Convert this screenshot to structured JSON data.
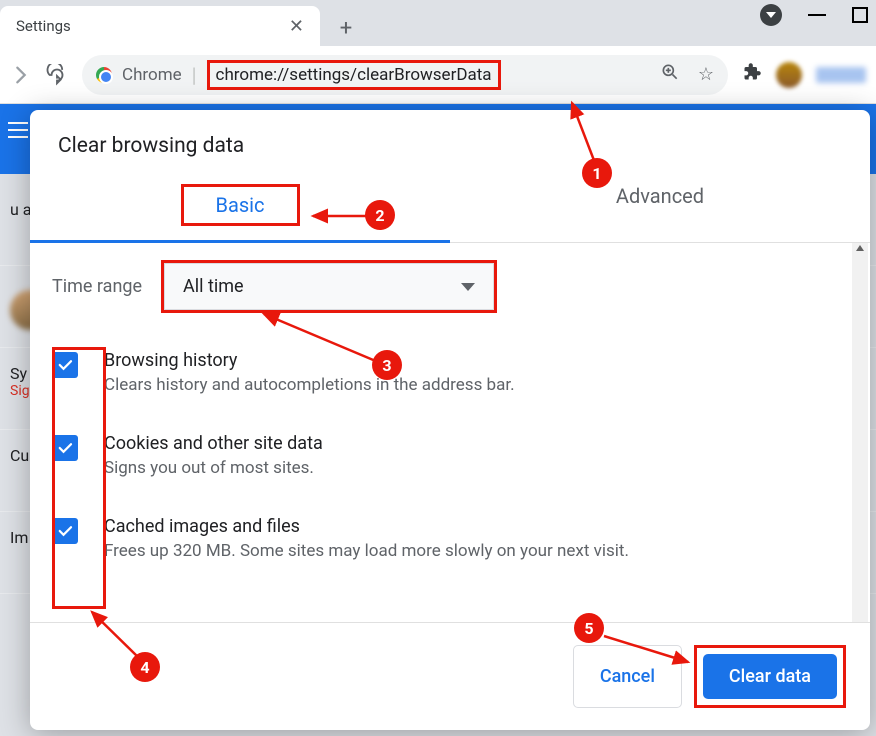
{
  "tab": {
    "title": "Settings"
  },
  "omnibox": {
    "label": "Chrome",
    "url": "chrome://settings/clearBrowserData"
  },
  "background": {
    "row1_truncated": "u a",
    "row2_label": "Sy",
    "row2_sub": "Sig",
    "row3_label": "Cu",
    "row4_label": "Im"
  },
  "dialog": {
    "title": "Clear browsing data",
    "tabs": {
      "basic": "Basic",
      "advanced": "Advanced"
    },
    "time_range_label": "Time range",
    "time_range_value": "All time",
    "items": [
      {
        "title": "Browsing history",
        "desc": "Clears history and autocompletions in the address bar."
      },
      {
        "title": "Cookies and other site data",
        "desc": "Signs you out of most sites."
      },
      {
        "title": "Cached images and files",
        "desc": "Frees up 320 MB. Some sites may load more slowly on your next visit."
      }
    ],
    "cancel": "Cancel",
    "clear": "Clear data"
  },
  "annotations": {
    "n1": "1",
    "n2": "2",
    "n3": "3",
    "n4": "4",
    "n5": "5"
  }
}
